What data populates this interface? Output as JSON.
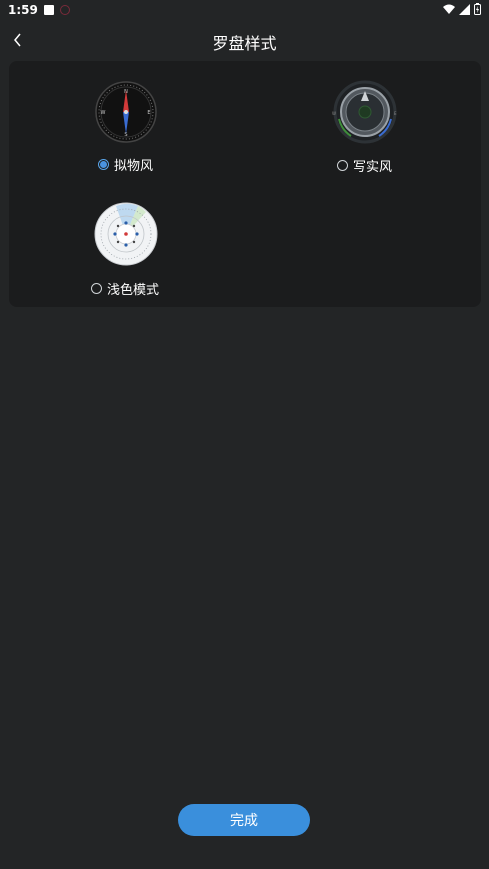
{
  "status_bar": {
    "time": "1:59"
  },
  "header": {
    "title": "罗盘样式"
  },
  "options": [
    {
      "label": "拟物风",
      "selected": true
    },
    {
      "label": "写实风",
      "selected": false
    },
    {
      "label": "浅色模式",
      "selected": false
    }
  ],
  "footer": {
    "done_label": "完成"
  },
  "colors": {
    "background": "#232526",
    "panel": "#1b1c1d",
    "accent": "#3a8fdc"
  }
}
